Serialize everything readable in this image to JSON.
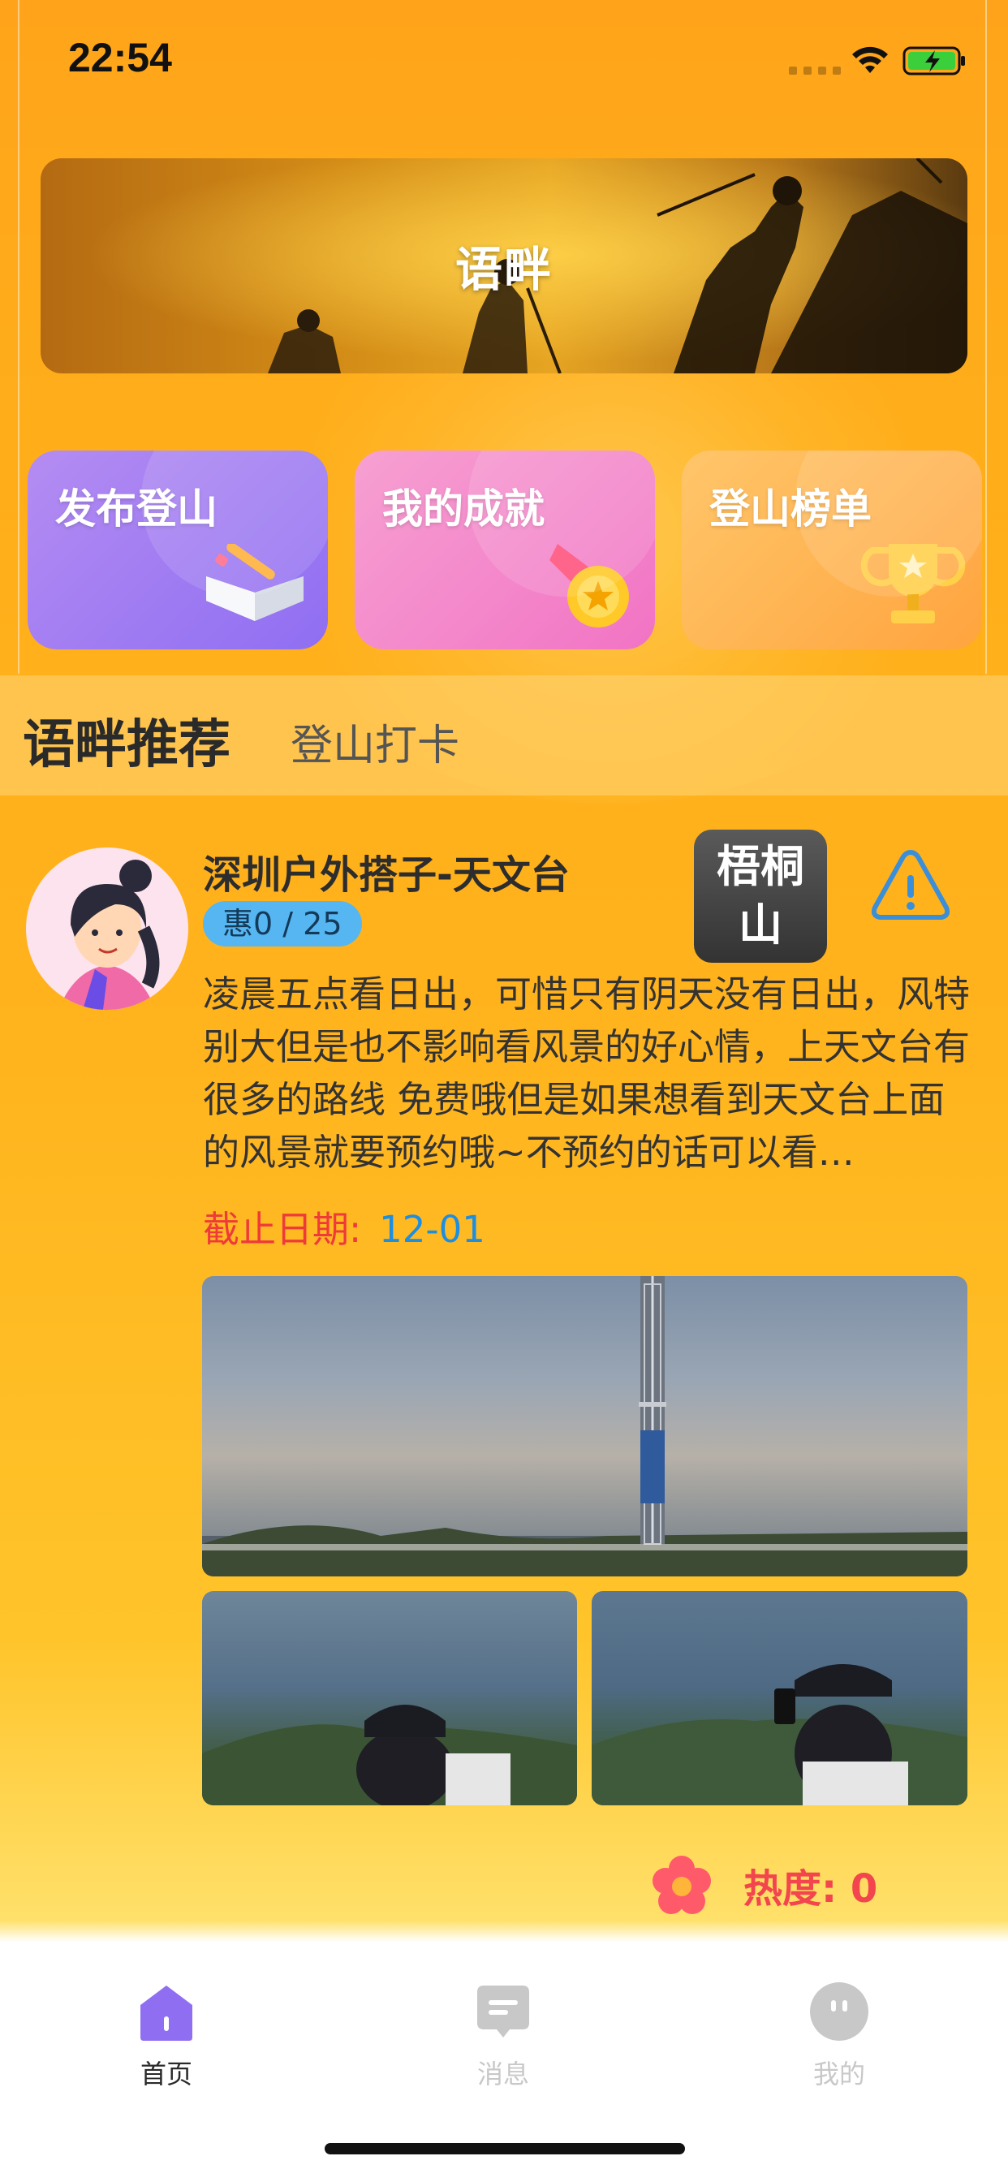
{
  "status_bar": {
    "time": "22:54"
  },
  "banner": {
    "title": "语畔"
  },
  "actions": [
    {
      "label": "发布登山",
      "icon": "book-pencil-icon"
    },
    {
      "label": "我的成就",
      "icon": "medal-icon"
    },
    {
      "label": "登山榜单",
      "icon": "trophy-icon"
    }
  ],
  "tabs": {
    "active": "语畔推荐",
    "inactive": "登山打卡"
  },
  "post": {
    "title": "深圳户外搭子-天文台",
    "tag": "惠0 / 25",
    "mountain": "梧桐山",
    "body": "凌晨五点看日出，可惜只有阴天没有日出，风特别大但是也不影响看风景的好心情，上天文台有很多的路线 免费哦但是如果想看到天文台上面的风景就要预约哦~不预约的话可以看…",
    "deadline_label": "截止日期:",
    "deadline_value": "12-01",
    "heat_label": "热度: 0"
  },
  "nav": [
    {
      "label": "首页",
      "icon": "home-icon",
      "active": true
    },
    {
      "label": "消息",
      "icon": "message-icon",
      "active": false
    },
    {
      "label": "我的",
      "icon": "profile-icon",
      "active": false
    }
  ],
  "colors": {
    "accent_orange": "#ffae1a",
    "deadline_red": "#ef3a3a",
    "deadline_blue": "#1e8ee0",
    "heat_red": "#f2454d",
    "nav_active": "#8f6ef2",
    "nav_inactive": "#c8c8c8"
  }
}
